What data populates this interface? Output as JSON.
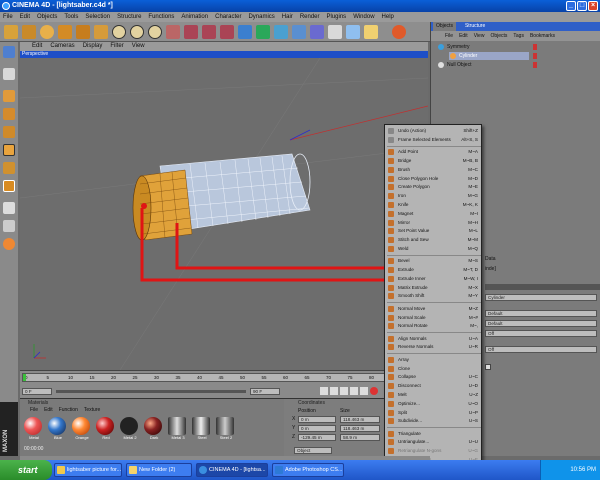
{
  "window": {
    "title": "CINEMA 4D - [lightsaber.c4d *]"
  },
  "menubar": [
    "File",
    "Edit",
    "Objects",
    "Tools",
    "Selection",
    "Structure",
    "Functions",
    "Animation",
    "Character",
    "Dynamics",
    "Hair",
    "Render",
    "Plugins",
    "Window",
    "Help"
  ],
  "viewport": {
    "menu": [
      "Edit",
      "Cameras",
      "Display",
      "Filter",
      "View"
    ],
    "label": "Perspective"
  },
  "objects_panel": {
    "tabs": [
      "Objects",
      "Structure"
    ],
    "menu": [
      "File",
      "Edit",
      "View",
      "Objects",
      "Tags",
      "Bookmarks"
    ],
    "items": [
      "Symmetry",
      "Cylinder",
      "Null Object"
    ]
  },
  "attributes_panel": {
    "tab_fragment": "Data",
    "mode_fragment": "inde]",
    "name_value": "Cylinder",
    "defaults": [
      "Default",
      "Default",
      "Off",
      "Off"
    ]
  },
  "context_menu": {
    "items": [
      {
        "label": "Undo (Action)",
        "shortcut": "Shift+Z"
      },
      {
        "label": "Frame Selected Elements",
        "shortcut": "Alt+S, S"
      },
      {
        "label": "Add Point",
        "shortcut": "M~A"
      },
      {
        "label": "Bridge",
        "shortcut": "M~B, B"
      },
      {
        "label": "Brush",
        "shortcut": "M~C"
      },
      {
        "label": "Close Polygon Hole",
        "shortcut": "M~D"
      },
      {
        "label": "Create Polygon",
        "shortcut": "M~E"
      },
      {
        "label": "Iron",
        "shortcut": "M~G"
      },
      {
        "label": "Knife",
        "shortcut": "M~K, K"
      },
      {
        "label": "Magnet",
        "shortcut": "M~I"
      },
      {
        "label": "Mirror",
        "shortcut": "M~H"
      },
      {
        "label": "Set Point Value",
        "shortcut": "M~L"
      },
      {
        "label": "Stitch and Sew",
        "shortcut": "M~M"
      },
      {
        "label": "Weld",
        "shortcut": "M~Q"
      },
      {
        "label": "Bevel",
        "shortcut": "M~S"
      },
      {
        "label": "Extrude",
        "shortcut": "M~T, D"
      },
      {
        "label": "Extrude Inner",
        "shortcut": "M~W, I"
      },
      {
        "label": "Matrix Extrude",
        "shortcut": "M~X"
      },
      {
        "label": "Smooth Shift",
        "shortcut": "M~Y"
      },
      {
        "label": "Normal Move",
        "shortcut": "M~Z"
      },
      {
        "label": "Normal Scale",
        "shortcut": "M~#"
      },
      {
        "label": "Normal Rotate",
        "shortcut": "M~,"
      },
      {
        "label": "Align Normals",
        "shortcut": "U~A"
      },
      {
        "label": "Reverse Normals",
        "shortcut": "U~R"
      },
      {
        "label": "Array",
        "shortcut": ""
      },
      {
        "label": "Clone",
        "shortcut": ""
      },
      {
        "label": "Collapse",
        "shortcut": "U~C"
      },
      {
        "label": "Disconnect",
        "shortcut": "U~D"
      },
      {
        "label": "Melt",
        "shortcut": "U~Z"
      },
      {
        "label": "Optimize...",
        "shortcut": "U~O"
      },
      {
        "label": "Split",
        "shortcut": "U~P"
      },
      {
        "label": "Subdivide...",
        "shortcut": "U~S"
      },
      {
        "label": "Triangulate",
        "shortcut": ""
      },
      {
        "label": "Untriangulate...",
        "shortcut": "U~U"
      },
      {
        "label": "Retriangulate N-gons",
        "shortcut": "U~G"
      },
      {
        "label": "Remove N-gons",
        "shortcut": "U~E"
      }
    ]
  },
  "timeline": {
    "ticks": [
      "0",
      "5",
      "10",
      "15",
      "20",
      "25",
      "30",
      "35",
      "40",
      "45",
      "50",
      "55",
      "60",
      "65",
      "70",
      "75",
      "80",
      "85",
      "90"
    ],
    "start": "0 F",
    "end": "90 F"
  },
  "materials": {
    "title": "Materials",
    "menu": [
      "File",
      "Edit",
      "Function",
      "Texture"
    ],
    "swatches": [
      "Metal",
      "Blue",
      "Orange",
      "Red",
      "Metal 2",
      "Dark",
      "Metal 3",
      "Steel",
      "Steel 2"
    ]
  },
  "coordinates": {
    "title": "Coordinates",
    "col_position": "Position",
    "col_size": "Size",
    "rows": [
      {
        "axis": "X",
        "position": "0 m",
        "size": "118.463 m"
      },
      {
        "axis": "Y",
        "position": "0 m",
        "size": "118.463 m"
      },
      {
        "axis": "Z",
        "position": "-129.45 m",
        "size": "58.9 m"
      }
    ],
    "mode": "Object"
  },
  "status": {
    "time": "00:00:00"
  },
  "taskbar": {
    "start": "start",
    "tasks": [
      "lightsaber picture for...",
      "New Folder (2)",
      "CINEMA 4D - [lightsa...",
      "Adobe Photoshop CS..."
    ],
    "clock": "10:56 PM"
  },
  "colors": {
    "orange": "#e0a23a",
    "mesh": "#c9d6ea",
    "arrow": "#e01414",
    "selection_blue": "#1e4fc7"
  }
}
